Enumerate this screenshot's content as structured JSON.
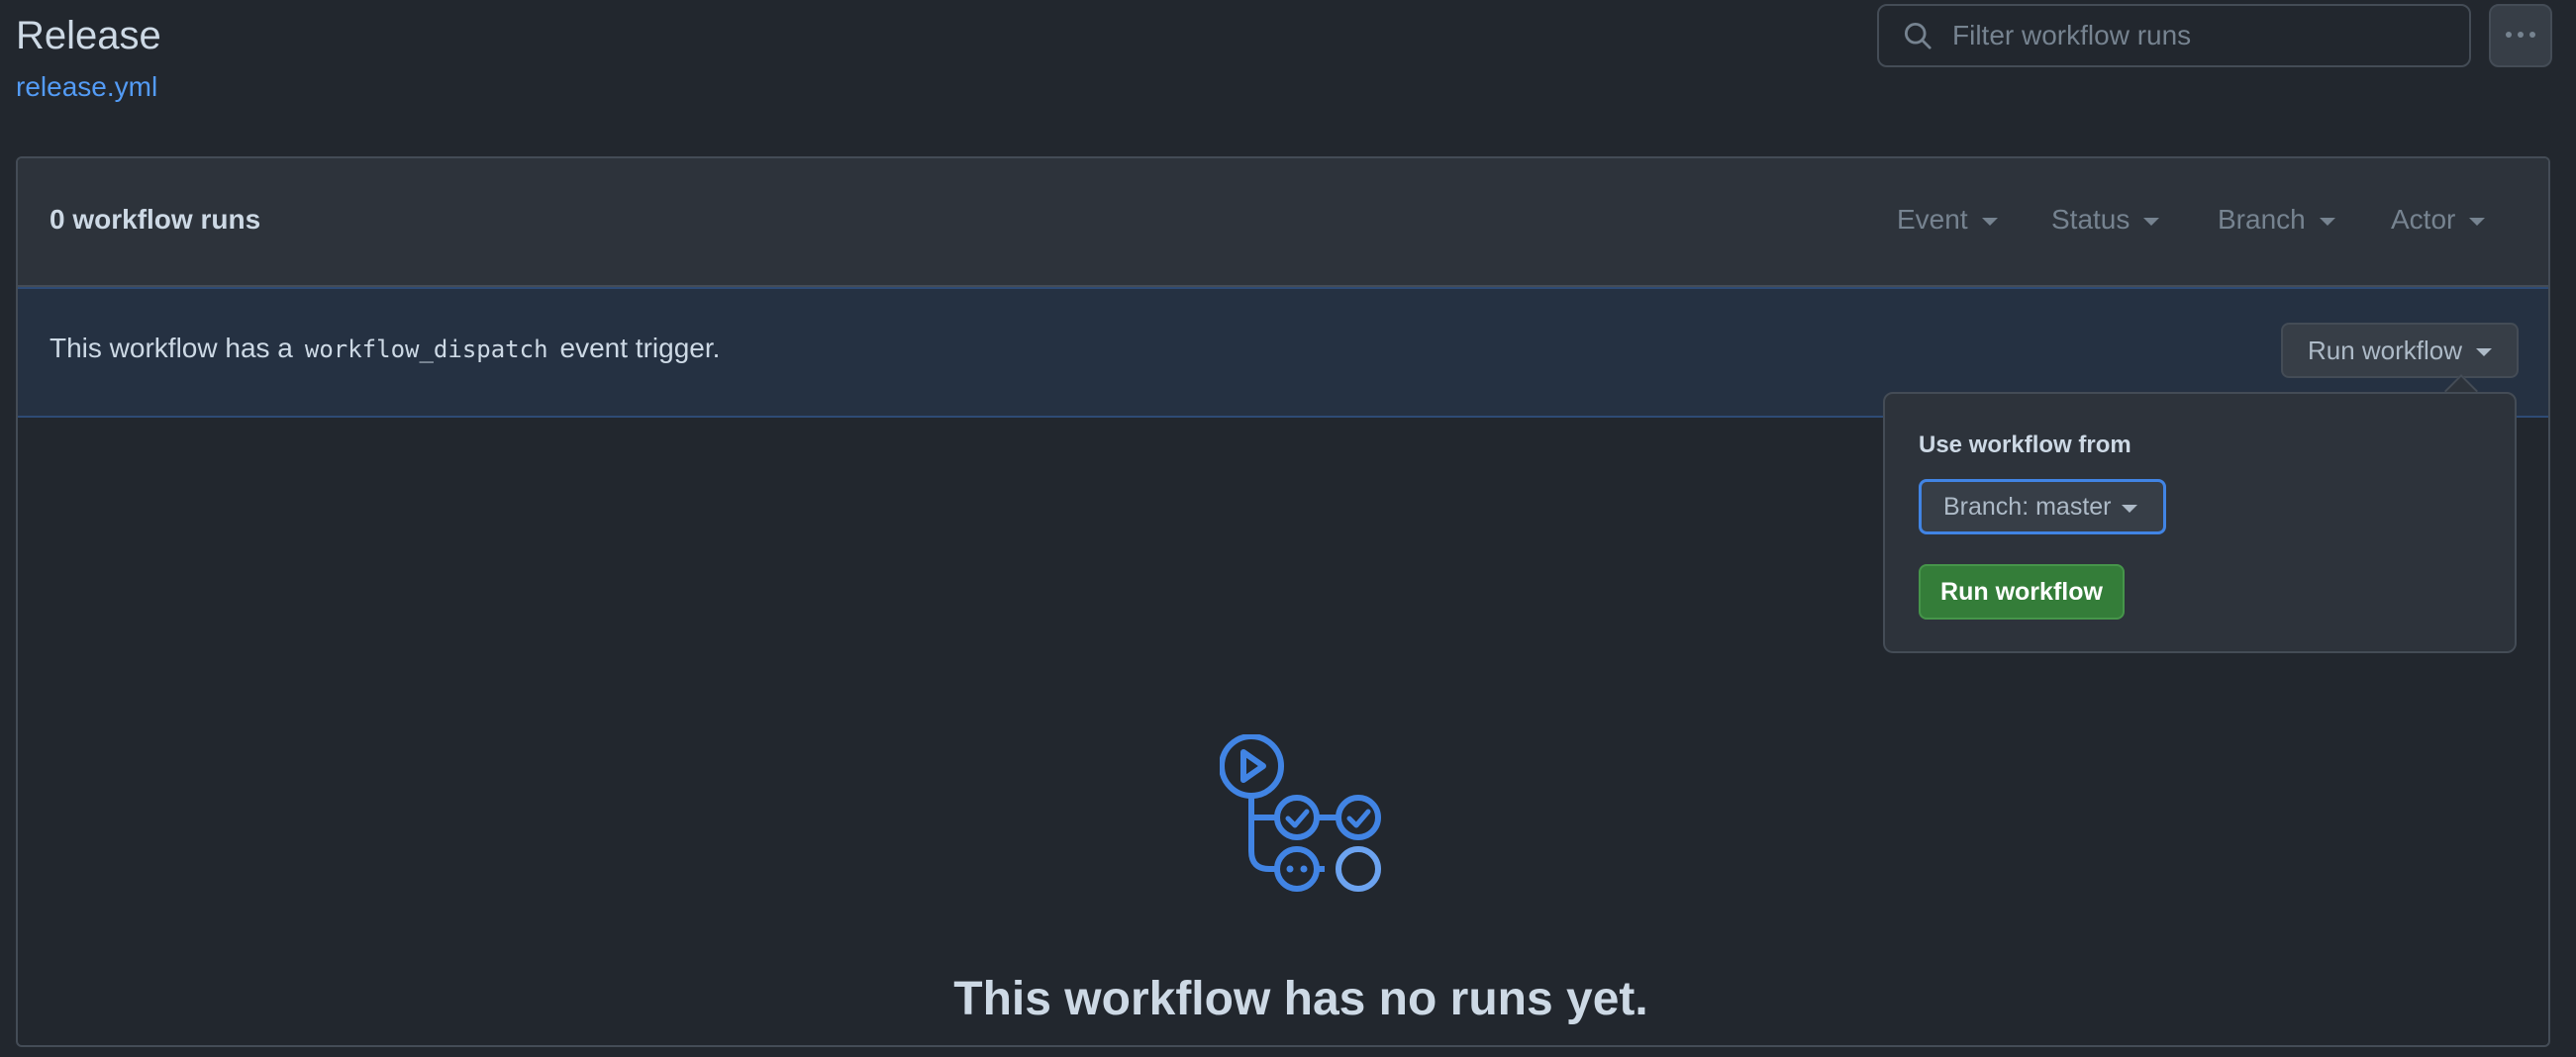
{
  "header": {
    "title": "Release",
    "workflow_file": "release.yml"
  },
  "search": {
    "placeholder": "Filter workflow runs",
    "icon": "search-icon"
  },
  "more_button": {
    "icon": "kebab-horizontal-icon"
  },
  "runs_header": {
    "count_label": "0 workflow runs",
    "filters": [
      {
        "label": "Event"
      },
      {
        "label": "Status"
      },
      {
        "label": "Branch"
      },
      {
        "label": "Actor"
      }
    ]
  },
  "dispatch": {
    "text_before": "This workflow has a",
    "code": "workflow_dispatch",
    "text_after": "event trigger.",
    "run_button_label": "Run workflow"
  },
  "dropdown": {
    "label": "Use workflow from",
    "branch_select": "Branch: master",
    "run_button_label": "Run workflow"
  },
  "empty_state": {
    "icon": "workflow-icon",
    "title": "This workflow has no runs yet."
  },
  "colors": {
    "background": "#22272e",
    "accent": "#539bf5",
    "primary_button": "#347d39",
    "dispatch_bar": "#253142"
  }
}
